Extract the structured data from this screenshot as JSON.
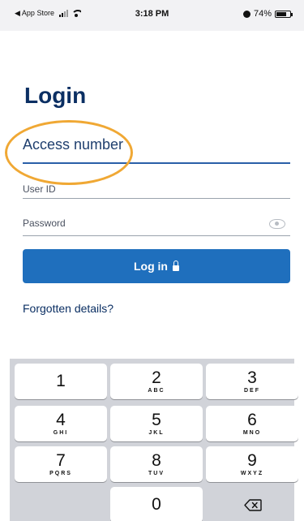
{
  "status_bar": {
    "back_label": "◀ App Store",
    "time": "3:18 PM",
    "battery": "74%",
    "battery_level": 0.74
  },
  "login": {
    "title": "Login",
    "access_number_label": "Access number",
    "user_id_label": "User ID",
    "password_label": "Password",
    "login_button": "Log in",
    "forgotten_link": "Forgotten details?"
  },
  "keypad": {
    "keys": [
      {
        "num": "1",
        "letters": ""
      },
      {
        "num": "2",
        "letters": "ABC"
      },
      {
        "num": "3",
        "letters": "DEF"
      },
      {
        "num": "4",
        "letters": "GHI"
      },
      {
        "num": "5",
        "letters": "JKL"
      },
      {
        "num": "6",
        "letters": "MNO"
      },
      {
        "num": "7",
        "letters": "PQRS"
      },
      {
        "num": "8",
        "letters": "TUV"
      },
      {
        "num": "9",
        "letters": "WXYZ"
      },
      {
        "num": "0",
        "letters": ""
      }
    ],
    "delete_icon": "backspace-icon"
  },
  "colors": {
    "brand_navy": "#0b2f63",
    "button_blue": "#1f6fbd",
    "highlight_orange": "#f0a834",
    "keyboard_bg": "#d1d3d9"
  }
}
